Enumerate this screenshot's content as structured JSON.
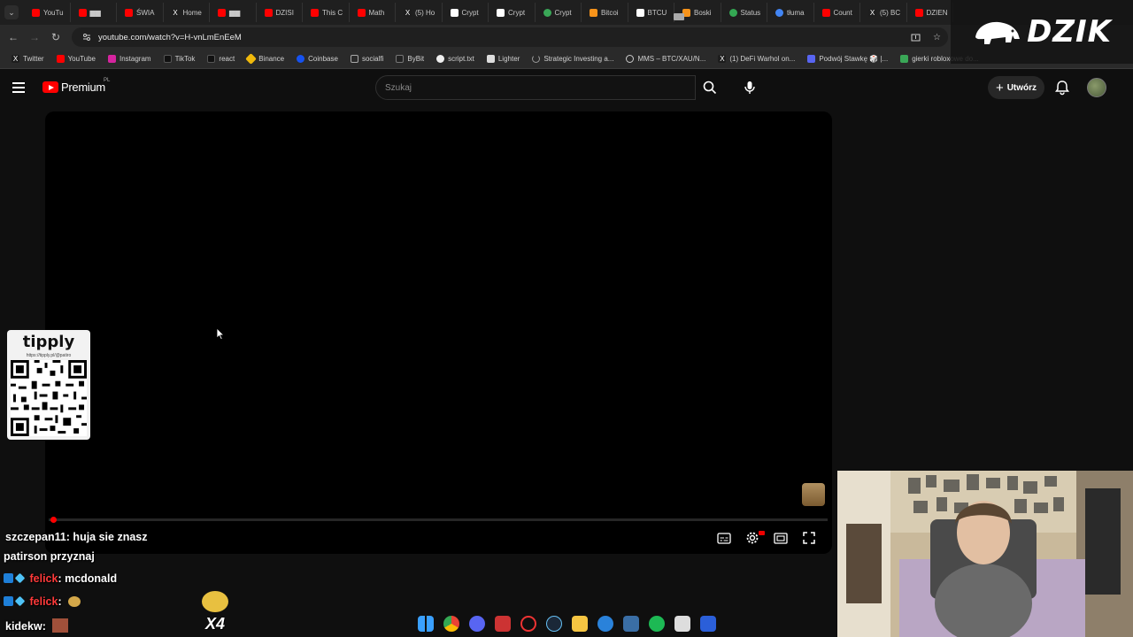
{
  "browser": {
    "tabs": [
      {
        "label": "YouTu",
        "color": "#ff0000"
      },
      {
        "label": "▆▆",
        "color": "#ff0000"
      },
      {
        "label": "ŚWIA",
        "color": "#ff0000"
      },
      {
        "label": "Home",
        "color": "#1d1d1d"
      },
      {
        "label": "▆▆",
        "color": "#ff0000"
      },
      {
        "label": "DZISI",
        "color": "#ff0000"
      },
      {
        "label": "This C",
        "color": "#ff0000"
      },
      {
        "label": "Math",
        "color": "#ff0000"
      },
      {
        "label": "(5) Ho",
        "color": "#1d1d1d"
      },
      {
        "label": "Crypt",
        "color": "#ffffff"
      },
      {
        "label": "Crypt",
        "color": "#ffffff"
      },
      {
        "label": "Crypt",
        "color": "#3aa757"
      },
      {
        "label": "Bitcoi",
        "color": "#f7931a"
      },
      {
        "label": "BTCU",
        "color": "#ffffff"
      },
      {
        "label": "Boski",
        "color": "#f7931a"
      },
      {
        "label": "Status",
        "color": "#34a853"
      },
      {
        "label": "tłuma",
        "color": "#4285f4"
      },
      {
        "label": "Count",
        "color": "#ff0000"
      },
      {
        "label": "(5) BC",
        "color": "#1d1d1d"
      },
      {
        "label": "DZIEN",
        "color": "#ff0000"
      }
    ],
    "url": "youtube.com/watch?v=H-vnLmEnEeM",
    "bookmarks": [
      {
        "label": "Twitter",
        "color": "#1d1d1d"
      },
      {
        "label": "YouTube",
        "color": "#ff0000"
      },
      {
        "label": "Instagram",
        "color": "#d6249f"
      },
      {
        "label": "TikTok",
        "color": "#111111"
      },
      {
        "label": "react",
        "color": "#111111"
      },
      {
        "label": "Binance",
        "color": "#f0b90b"
      },
      {
        "label": "Coinbase",
        "color": "#1652f0"
      },
      {
        "label": "socialfi",
        "color": "#888888"
      },
      {
        "label": "ByBit",
        "color": "#222222"
      },
      {
        "label": "script.txt",
        "color": "#eeeeee"
      },
      {
        "label": "Lighter",
        "color": "#dddddd"
      },
      {
        "label": "Strategic Investing a...",
        "color": "#999999"
      },
      {
        "label": "MMS – BTC/XAU/N...",
        "color": "#cccccc"
      },
      {
        "label": "(1) DeFi Warhol on...",
        "color": "#1d1d1d"
      },
      {
        "label": "Podwój Stawkę 🎲 |...",
        "color": "#5865f2"
      },
      {
        "label": "gierki robloxowe do...",
        "color": "#3aa757"
      }
    ]
  },
  "overlay": {
    "dzik_logo": "DZIK"
  },
  "youtube": {
    "brand": "Premium",
    "region": "PL",
    "search_placeholder": "Szukaj",
    "create_label": "Utwórz"
  },
  "tipply": {
    "title": "tipply",
    "url": "https://tipply.pl/@patiro"
  },
  "chat": [
    {
      "nick": "szczepan11",
      "message": ": huja sie znasz"
    },
    {
      "nick": "",
      "message": "patirson przyznaj"
    },
    {
      "nick": "felick",
      "message": ": mcdonald"
    },
    {
      "nick": "felick",
      "message": ":"
    },
    {
      "nick": "kidekw",
      "message": ":"
    }
  ],
  "emote_multiplier": "X4",
  "taskbar_icons": [
    "windows-start",
    "chrome",
    "discord",
    "app-red",
    "app-spinner",
    "steam",
    "file-explorer",
    "ccleaner",
    "app-blue",
    "spotify",
    "app-cam",
    "app-x"
  ]
}
